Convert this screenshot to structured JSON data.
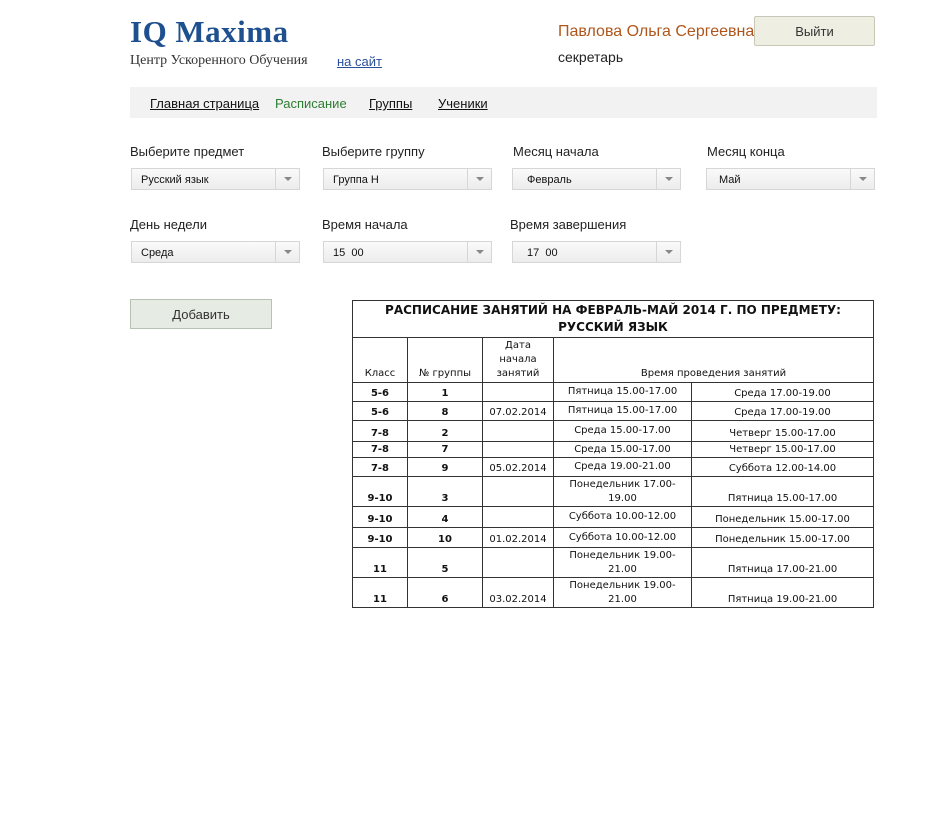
{
  "header": {
    "logo": "IQ Maxima",
    "subtitle": "Центр Ускоренного Обучения",
    "site_link": "на сайт",
    "user_name": "Павлова Ольга Сергеевна",
    "user_role": "секретарь",
    "logout_label": "Выйти"
  },
  "nav": {
    "items": [
      {
        "label": "Главная страница"
      },
      {
        "label": "Расписание"
      },
      {
        "label": "Группы"
      },
      {
        "label": "Ученики"
      }
    ],
    "active": "Расписание"
  },
  "form": {
    "subject": {
      "label": "Выберите предмет",
      "value": "Русский язык"
    },
    "group": {
      "label": "Выберите группу",
      "value": "Группа Н"
    },
    "month_start": {
      "label": "Месяц начала",
      "value": "Февраль"
    },
    "month_end": {
      "label": "Месяц конца",
      "value": "Май"
    },
    "weekday": {
      "label": "День недели",
      "value": "Среда"
    },
    "time_start": {
      "label": "Время начала",
      "value": "15  00"
    },
    "time_end": {
      "label": "Время завершения",
      "value": "17  00"
    },
    "add_label": "Добавить"
  },
  "schedule": {
    "title": "РАСПИСАНИЕ ЗАНЯТИЙ НА ФЕВРАЛЬ-МАЙ 2014 Г. ПО ПРЕДМЕТУ: РУССКИЙ ЯЗЫК",
    "headers": {
      "class": "Класс",
      "group": "№ группы",
      "date": "Дата начала занятий",
      "time": "Время проведения занятий"
    },
    "rows": [
      {
        "class": "5-6",
        "group": "1",
        "date": "",
        "slot1": "Пятница 15.00-17.00",
        "slot2": "Среда 17.00-19.00"
      },
      {
        "class": "5-6",
        "group": "8",
        "date": "07.02.2014",
        "slot1": "Пятница 15.00-17.00",
        "slot2": "Среда 17.00-19.00"
      },
      {
        "class": "7-8",
        "group": "2",
        "date": "",
        "slot1": "Среда 15.00-17.00",
        "slot2": "Четверг 15.00-17.00"
      },
      {
        "class": "7-8",
        "group": "7",
        "date": "",
        "slot1": "Среда 15.00-17.00",
        "slot2": "Четверг 15.00-17.00"
      },
      {
        "class": "7-8",
        "group": "9",
        "date": "05.02.2014",
        "slot1": "Среда 19.00-21.00",
        "slot2": "Суббота 12.00-14.00"
      },
      {
        "class": "9-10",
        "group": "3",
        "date": "",
        "slot1": "Понедельник 17.00-19.00",
        "slot2": "Пятница 15.00-17.00"
      },
      {
        "class": "9-10",
        "group": "4",
        "date": "",
        "slot1": "Суббота 10.00-12.00",
        "slot2": "Понедельник 15.00-17.00"
      },
      {
        "class": "9-10",
        "group": "10",
        "date": "01.02.2014",
        "slot1": "Суббота 10.00-12.00",
        "slot2": "Понедельник 15.00-17.00"
      },
      {
        "class": "11",
        "group": "5",
        "date": "",
        "slot1": "Понедельник 19.00-21.00",
        "slot2": "Пятница 17.00-21.00"
      },
      {
        "class": "11",
        "group": "6",
        "date": "03.02.2014",
        "slot1": "Понедельник 19.00-21.00",
        "slot2": "Пятница 19.00-21.00"
      }
    ]
  }
}
